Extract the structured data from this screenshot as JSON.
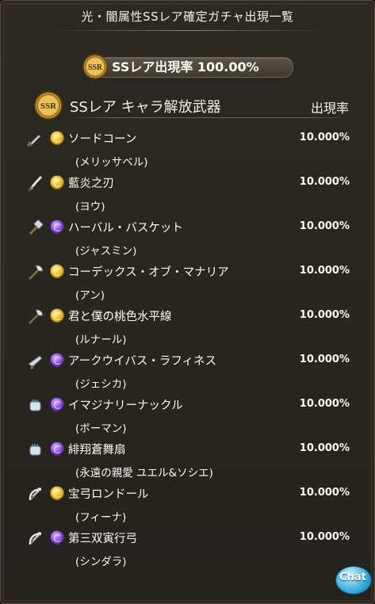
{
  "header": {
    "title": "光・闇属性SSレア確定ガチャ出現一覧"
  },
  "summary": {
    "badge_label": "SSR",
    "rate_text": "SSレア出現率 100.00%"
  },
  "section": {
    "badge_label": "SSR",
    "title": "SSレア キャラ解放武器",
    "rate_label": "出現率"
  },
  "items": [
    {
      "weapon": "ソードコーン",
      "character": "(メリッサベル)",
      "rate": "10.000%",
      "element": "light",
      "weapon_icon": "sword-icon"
    },
    {
      "weapon": "藍炎之刃",
      "character": "(ヨウ)",
      "rate": "10.000%",
      "element": "light",
      "weapon_icon": "katana-icon"
    },
    {
      "weapon": "ハーバル・バスケット",
      "character": "(ジャスミン)",
      "rate": "10.000%",
      "element": "dark",
      "weapon_icon": "hammer-icon"
    },
    {
      "weapon": "コーデックス・オブ・マナリア",
      "character": "(アン)",
      "rate": "10.000%",
      "element": "light",
      "weapon_icon": "axe-icon"
    },
    {
      "weapon": "君と僕の桃色水平線",
      "character": "(ルナール)",
      "rate": "10.000%",
      "element": "light",
      "weapon_icon": "axe-icon"
    },
    {
      "weapon": "アークウイバス・ラフィネス",
      "character": "(ジェシカ)",
      "rate": "10.000%",
      "element": "dark",
      "weapon_icon": "gun-icon"
    },
    {
      "weapon": "イマジナリーナックル",
      "character": "(ボーマン)",
      "rate": "10.000%",
      "element": "dark",
      "weapon_icon": "fist-icon"
    },
    {
      "weapon": "緋翔蒼舞扇",
      "character": "(永遠の親愛 ユエル&ソシエ)",
      "rate": "10.000%",
      "element": "dark",
      "weapon_icon": "fist-icon"
    },
    {
      "weapon": "宝弓ロンドール",
      "character": "(フィーナ)",
      "rate": "10.000%",
      "element": "light",
      "weapon_icon": "bow-icon"
    },
    {
      "weapon": "第三双寅行弓",
      "character": "(シンダラ)",
      "rate": "10.000%",
      "element": "dark",
      "weapon_icon": "bow-icon"
    }
  ],
  "chat": {
    "label": "Chat",
    "icon": "chat-bubble-icon"
  },
  "colors": {
    "panel": "#2a2722",
    "border": "#4a4236",
    "text": "#fbfaf5",
    "light_element": "#e6b21c",
    "dark_element": "#7a3fd0",
    "chat": "#37a9d9"
  }
}
